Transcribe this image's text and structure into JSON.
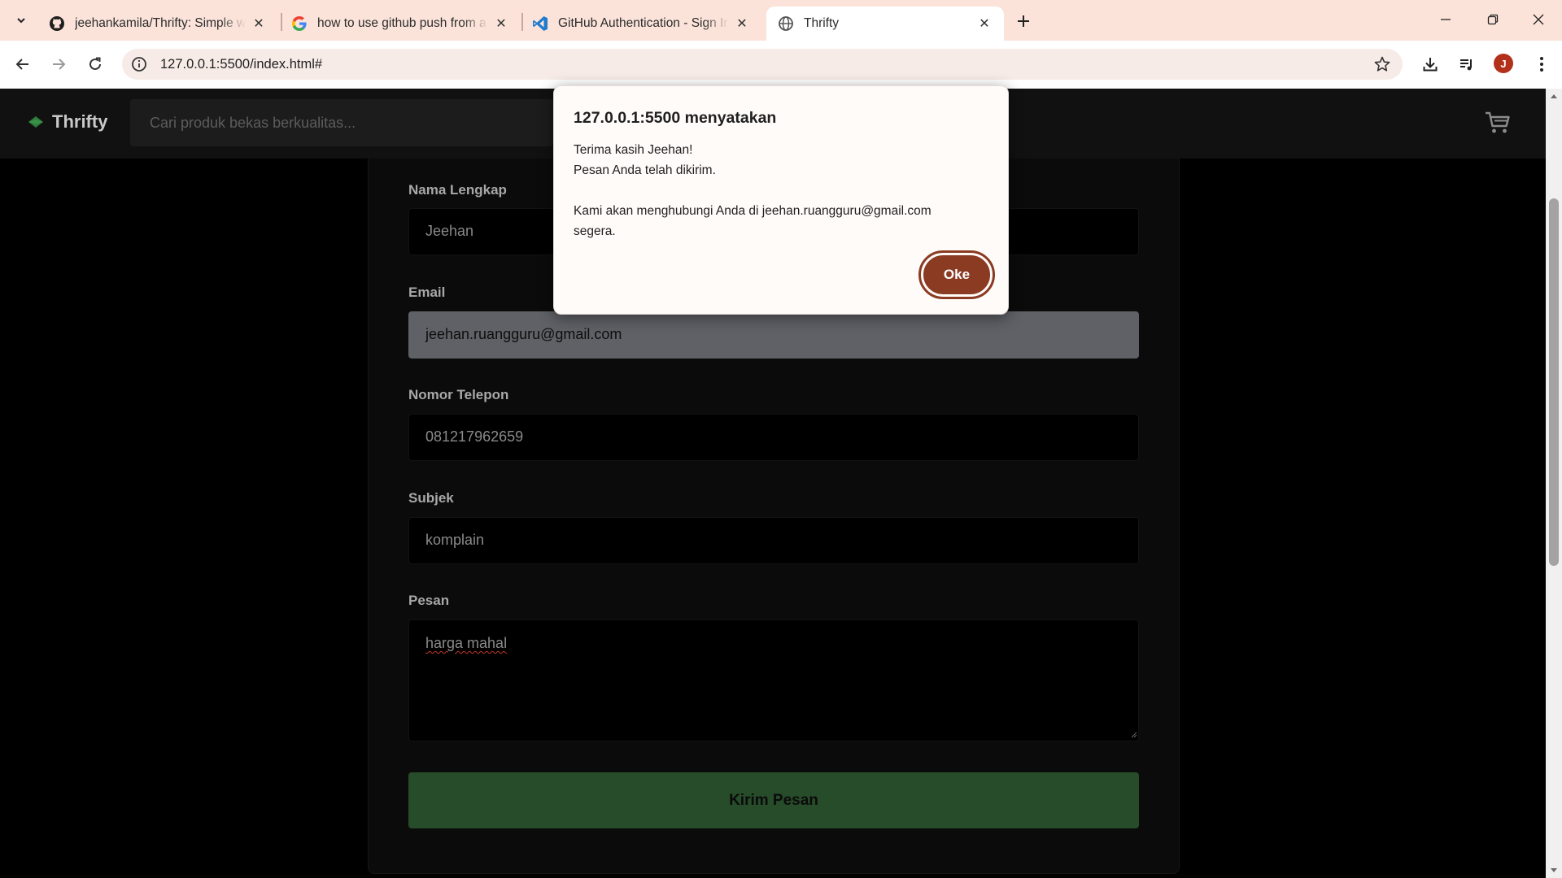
{
  "browser": {
    "tabs": [
      {
        "title": "jeehankamila/Thrifty: Simple we",
        "icon": "github-icon",
        "active": false
      },
      {
        "title": "how to use github push from a",
        "icon": "google-icon",
        "active": false
      },
      {
        "title": "GitHub Authentication - Sign In",
        "icon": "vscode-icon",
        "active": false
      },
      {
        "title": "Thrifty",
        "icon": "globe-icon",
        "active": true
      }
    ],
    "url": "127.0.0.1:5500/index.html#",
    "profile_initial": "J",
    "chrome_color": "#fbe3da"
  },
  "site": {
    "brand": "Thrifty",
    "search_placeholder": "Cari produk bekas berkualitas...",
    "cart_icon": "cart-icon"
  },
  "form": {
    "name": {
      "label": "Nama Lengkap",
      "value": "Jeehan"
    },
    "email": {
      "label": "Email",
      "value": "jeehan.ruangguru@gmail.com"
    },
    "phone": {
      "label": "Nomor Telepon",
      "value": "081217962659"
    },
    "subject": {
      "label": "Subjek",
      "value": "komplain"
    },
    "message": {
      "label": "Pesan",
      "value": "harga mahal"
    },
    "submit_label": "Kirim Pesan",
    "submit_color": "#264c29"
  },
  "dialog": {
    "title": "127.0.0.1:5500 menyatakan",
    "line1": "Terima kasih Jeehan!",
    "line2": "Pesan Anda telah dikirim.",
    "line3": "Kami akan menghubungi Anda di jeehan.ruangguru@gmail.com",
    "line4": "segera.",
    "ok_label": "Oke",
    "ok_color": "#8a3b22"
  }
}
